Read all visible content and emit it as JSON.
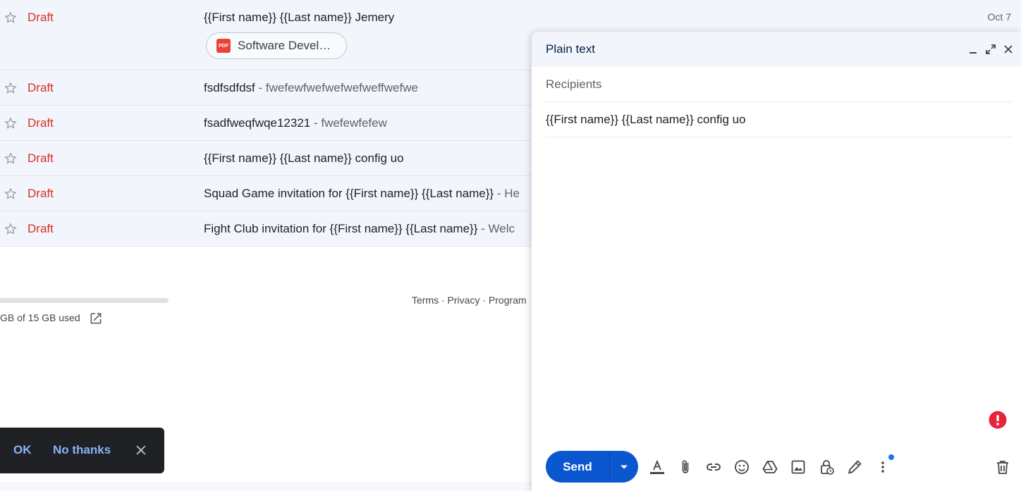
{
  "mail_list": {
    "rows": [
      {
        "label": "Draft",
        "subject": "{{First name}} {{Last name}} Jemery",
        "snippet": "",
        "date": "Oct 7",
        "attachment": "Software Devel…"
      },
      {
        "label": "Draft",
        "subject": "fsdfsdfdsf",
        "snippet": " - fwefewfwefwefwefweffwefwe"
      },
      {
        "label": "Draft",
        "subject": "fsadfweqfwqe12321",
        "snippet": " - fwefewfefew"
      },
      {
        "label": "Draft",
        "subject": "{{First name}} {{Last name}} config uo",
        "snippet": ""
      },
      {
        "label": "Draft",
        "subject": "Squad Game invitation for {{First name}} {{Last name}}",
        "snippet": " - He"
      },
      {
        "label": "Draft",
        "subject": "Fight Club invitation for {{First name}} {{Last name}}",
        "snippet": " - Welc"
      }
    ],
    "pdf_badge": "PDF"
  },
  "footer": {
    "storage_text": "GB of 15 GB used",
    "links": "Terms · Privacy · Program"
  },
  "snackbar": {
    "ok_label": "OK",
    "no_thanks_label": "No thanks"
  },
  "compose": {
    "title": "Plain text",
    "recipients_placeholder": "Recipients",
    "subject_value": "{{First name}} {{Last name}} config uo",
    "send_label": "Send",
    "icons": {
      "minimize": "minimize-icon",
      "expand": "expand-icon",
      "close": "close-icon",
      "format": "text-format-icon",
      "attach": "paperclip-icon",
      "link": "link-icon",
      "emoji": "emoji-icon",
      "drive": "drive-icon",
      "photo": "photo-icon",
      "confidential": "lock-clock-icon",
      "signature": "pen-icon",
      "more": "more-vert-icon",
      "discard": "trash-icon",
      "alert": "alert-icon"
    }
  },
  "colors": {
    "draft_red": "#d93025",
    "row_bg": "#f2f6fc",
    "send_blue": "#0b57d0",
    "alert_red": "#e8233a",
    "snackbar_bg": "#202124",
    "snackbar_link": "#8ab4f8"
  }
}
